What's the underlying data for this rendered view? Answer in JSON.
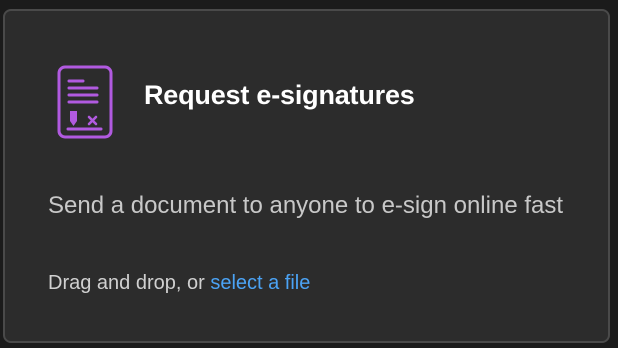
{
  "card": {
    "title": "Request e-signatures",
    "icon": "esign-document-icon",
    "description": "Send a document to anyone to e-sign online fast",
    "drop_prefix": "Drag and drop, or ",
    "select_link": "select a file"
  },
  "colors": {
    "accent": "#b15ae0",
    "link": "#4ba3f5",
    "card_background": "#2c2c2c"
  }
}
